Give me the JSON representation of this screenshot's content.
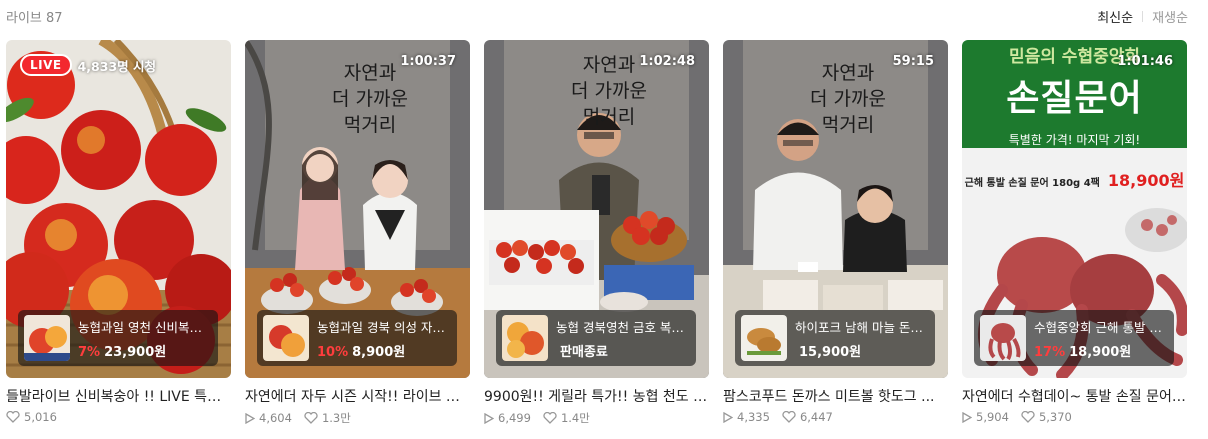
{
  "header": {
    "title": "라이브 87",
    "sort": [
      "최신순",
      "재생순"
    ]
  },
  "cards": [
    {
      "live_label": "LIVE",
      "viewers": "4,833명 시청",
      "duration": "",
      "product": {
        "name": "농협과일 영천 신비복숭아 ...",
        "discount": "7%",
        "price": "23,900원"
      },
      "title": "들발라이브 신비복숭아 !! LIVE 특가 ...",
      "views": "",
      "likes": "5,016"
    },
    {
      "live_label": "",
      "viewers": "",
      "duration": "1:00:37",
      "product": {
        "name": "농협과일 경북 의성 자두 ...",
        "discount": "10%",
        "price": "8,900원"
      },
      "title": "자연에더 자두 시즌 시작!! 라이브 특가 ...",
      "views": "4,604",
      "likes": "1.3만"
    },
    {
      "live_label": "",
      "viewers": "",
      "duration": "1:02:48",
      "product": {
        "name": "농협 경북영천 금호 복숭아 ...",
        "discount": "",
        "price": "판매종료"
      },
      "title": "9900원!! 게릴라 특가!! 농협 천도 복숭아 ...",
      "views": "6,499",
      "likes": "1.4만"
    },
    {
      "live_label": "",
      "viewers": "",
      "duration": "59:15",
      "product": {
        "name": "하이포크 남해 마늘 돈까스 ...",
        "discount": "",
        "price": "15,900원"
      },
      "title": "팜스코푸드 돈까스 미트볼 핫도그 ...",
      "views": "4,335",
      "likes": "6,447"
    },
    {
      "live_label": "",
      "viewers": "",
      "duration": "1:01:46",
      "product": {
        "name": "수협중앙회 근해 통발 손질 문어 ...",
        "discount": "17%",
        "price": "18,900원"
      },
      "title": "자연에더 수협데이~ 통발 손질 문어 ...",
      "views": "5,904",
      "likes": "5,370"
    }
  ],
  "banner": {
    "studio_lines": [
      "자연과",
      "더 가까운",
      "먹거리"
    ],
    "octopus_top": "믿음의 수협중앙회",
    "octopus_main": "손질문어",
    "octopus_sub": "특별한 가격! 마지막 기회!",
    "octopus_item": "근해 통발 손질 문어 180g 4팩",
    "octopus_price": "18,900원"
  },
  "colors": {
    "live_red": "#f3282e",
    "discount_red": "#ff3d3d",
    "octopus_green": "#1d7a2e"
  }
}
